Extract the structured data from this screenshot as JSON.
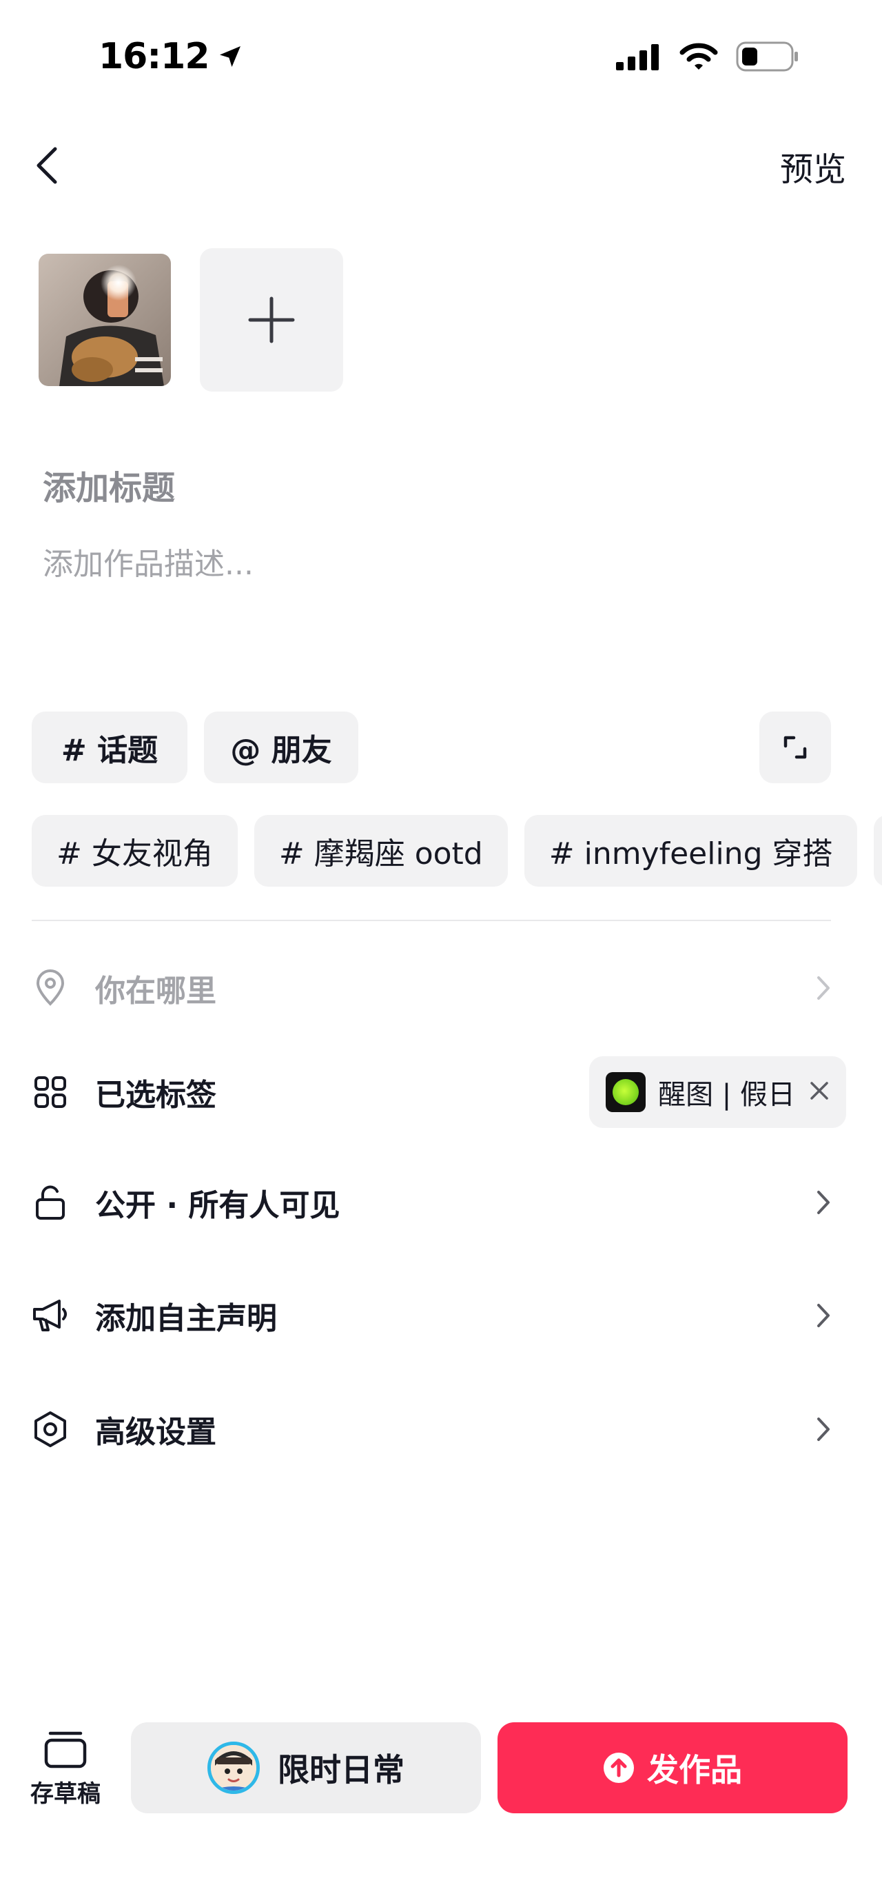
{
  "status_bar": {
    "time": "16:12"
  },
  "header": {
    "preview_label": "预览"
  },
  "composer": {
    "title_placeholder": "添加标题",
    "description_placeholder": "添加作品描述..."
  },
  "quick_actions": {
    "topic_label": "# 话题",
    "friend_label": "@ 朋友"
  },
  "suggested_hashtags": [
    "# 女友视角",
    "# 摩羯座 ootd",
    "# inmyfeeling 穿搭",
    "#"
  ],
  "settings": {
    "location_label": "你在哪里",
    "tags_label": "已选标签",
    "selected_tag": "醒图 | 假日",
    "visibility_label": "公开 · 所有人可见",
    "declaration_label": "添加自主声明",
    "advanced_label": "高级设置"
  },
  "bottom_bar": {
    "draft_label": "存草稿",
    "daily_label": "限时日常",
    "publish_label": "发作品"
  },
  "colors": {
    "accent": "#fe2c55",
    "chip_bg": "#f2f2f3",
    "text": "#161823",
    "muted": "#a3a4a9"
  },
  "icons": [
    "location-arrow-icon",
    "signal-icon",
    "wifi-icon",
    "battery-icon",
    "back-icon",
    "plus-icon",
    "expand-icon",
    "location-pin-icon",
    "grid-tags-icon",
    "close-icon",
    "lock-icon",
    "megaphone-icon",
    "settings-hexagon-icon",
    "chevron-right-icon",
    "draft-box-icon",
    "upload-arrow-icon"
  ]
}
